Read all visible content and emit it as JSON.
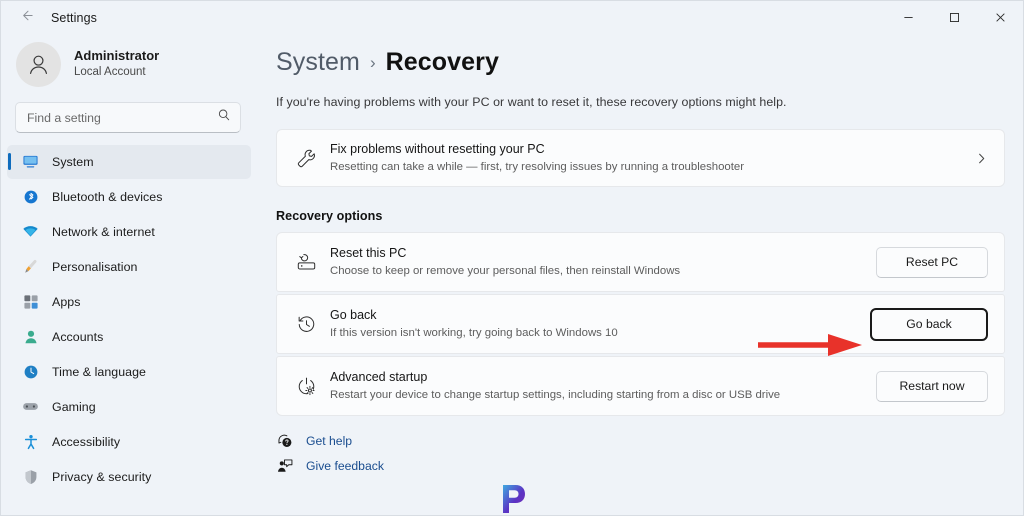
{
  "window": {
    "app_title": "Settings",
    "back_icon": "arrow-left-icon",
    "controls": [
      {
        "name": "minimize",
        "glyph": "─"
      },
      {
        "name": "maximize",
        "glyph": "☐"
      },
      {
        "name": "close",
        "glyph": "✕"
      }
    ]
  },
  "sidebar": {
    "account": {
      "name": "Administrator",
      "subtitle": "Local Account",
      "avatar_icon": "person-icon"
    },
    "search": {
      "placeholder": "Find a setting",
      "value": "",
      "icon": "search-icon"
    },
    "items": [
      {
        "label": "System",
        "icon": "monitor-icon",
        "selected": true
      },
      {
        "label": "Bluetooth & devices",
        "icon": "bluetooth-icon",
        "selected": false
      },
      {
        "label": "Network & internet",
        "icon": "wifi-icon",
        "selected": false
      },
      {
        "label": "Personalisation",
        "icon": "paintbrush-icon",
        "selected": false
      },
      {
        "label": "Apps",
        "icon": "apps-icon",
        "selected": false
      },
      {
        "label": "Accounts",
        "icon": "account-icon",
        "selected": false
      },
      {
        "label": "Time & language",
        "icon": "clock-globe-icon",
        "selected": false
      },
      {
        "label": "Gaming",
        "icon": "gamepad-icon",
        "selected": false
      },
      {
        "label": "Accessibility",
        "icon": "accessibility-icon",
        "selected": false
      },
      {
        "label": "Privacy & security",
        "icon": "shield-icon",
        "selected": false
      }
    ]
  },
  "main": {
    "breadcrumb": {
      "parent": "System",
      "separator": "›",
      "current": "Recovery"
    },
    "description": "If you're having problems with your PC or want to reset it, these recovery options might help.",
    "troubleshoot_card": {
      "icon": "wrench-icon",
      "title": "Fix problems without resetting your PC",
      "subtitle": "Resetting can take a while — first, try resolving issues by running a troubleshooter",
      "chevron": "chevron-right-icon"
    },
    "section_heading": "Recovery options",
    "options": [
      {
        "icon": "reset-pc-icon",
        "title": "Reset this PC",
        "subtitle": "Choose to keep or remove your personal files, then reinstall Windows",
        "button_label": "Reset PC",
        "focused": false
      },
      {
        "icon": "history-clock-icon",
        "title": "Go back",
        "subtitle": "If this version isn't working, try going back to Windows 10",
        "button_label": "Go back",
        "focused": true
      },
      {
        "icon": "power-gear-icon",
        "title": "Advanced startup",
        "subtitle": "Restart your device to change startup settings, including starting from a disc or USB drive",
        "button_label": "Restart now",
        "focused": false
      }
    ],
    "footer_links": [
      {
        "label": "Get help",
        "icon": "help-question-icon"
      },
      {
        "label": "Give feedback",
        "icon": "feedback-person-icon"
      }
    ]
  },
  "annotation": {
    "arrow_icon": "red-arrow-right-icon",
    "arrow_color": "#e8322a",
    "points_to": "Go back"
  },
  "watermark": {
    "icon": "p-logo-watermark",
    "color": "#5b33c4"
  },
  "colors": {
    "accent": "#0f6cbd",
    "link": "#1a4d8f",
    "sidebar_bg": "#eff3f8",
    "card_bg": "#fbfcfd",
    "selected_bg": "#e4e9ef"
  }
}
